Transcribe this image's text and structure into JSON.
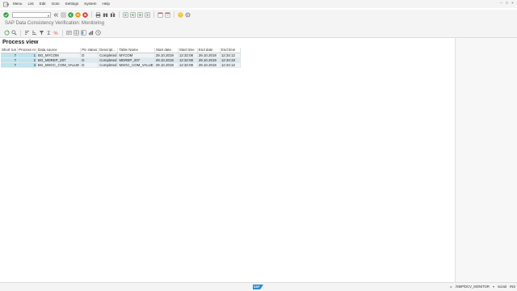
{
  "menubar": {
    "items": [
      "Menu",
      "List",
      "Edit",
      "Goto",
      "Settings",
      "System",
      "Help"
    ],
    "window_controls": [
      "–",
      "□",
      "×"
    ]
  },
  "toolbar1": {
    "command_field_value": ""
  },
  "title": "SAP Data Consistency Verification: Monitoring",
  "section_title": "Process view",
  "table": {
    "columns": [
      "Short run",
      "Process nr",
      "Data source",
      "Pic status",
      "Descript...",
      "Table Name",
      "Start date",
      "Start time",
      "End date",
      "End time"
    ],
    "rows": [
      [
        "7",
        "1",
        "BG_MYCOM",
        "D",
        "Completed",
        "MYCOM",
        "29.10.2019",
        "12:32:08",
        "29.10.2019",
        "12:34:12"
      ],
      [
        "7",
        "2",
        "BG_MDREP_207",
        "D",
        "Completed",
        "MDREP_207",
        "29.10.2019",
        "12:32:08",
        "29.10.2019",
        "12:34:33"
      ],
      [
        "7",
        "3",
        "BG_MSGC_COM_VALUE",
        "D",
        "Completed",
        "MSGC_COM_VALUE",
        "29.10.2019",
        "12:32:08",
        "29.10.2019",
        "12:34:12"
      ]
    ]
  },
  "statusbar": {
    "sap_logo": "SAP",
    "transaction": "/SMP/DCV_MONITOR",
    "user": "sozait",
    "mode": "INS"
  },
  "colors": {
    "accent_green": "#2e9e3e",
    "accent_orange": "#e8a020",
    "accent_red": "#d53a2a",
    "key_column": "#bfe4ee"
  }
}
